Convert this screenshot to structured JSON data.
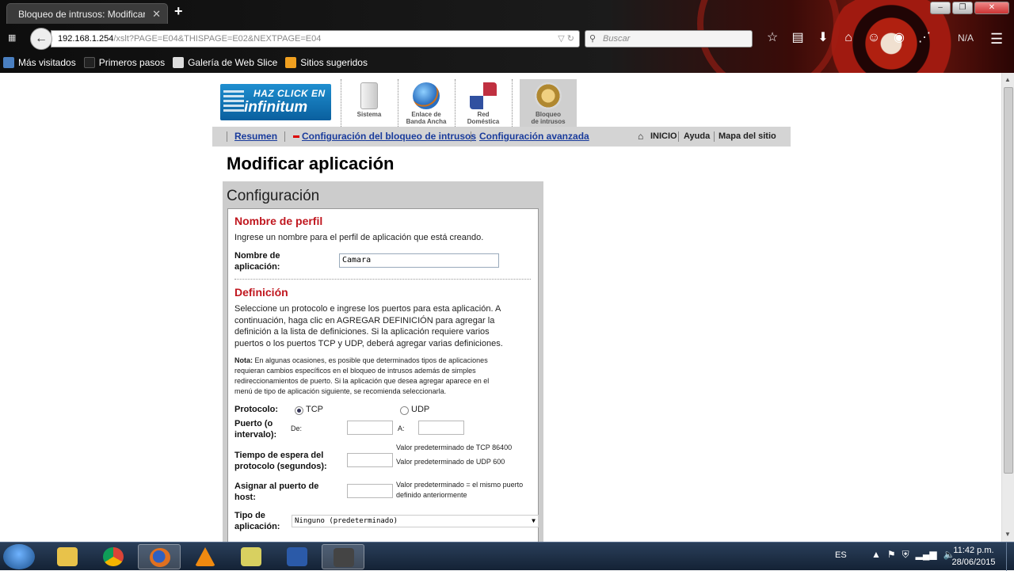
{
  "browser": {
    "tab_title": "Bloqueo de intrusos: Modificar ...",
    "tab_close": "✕",
    "new_tab": "+",
    "url_host": "192.168.1.254",
    "url_path": "/xslt?PAGE=E04&THISPAGE=E02&NEXTPAGE=E04",
    "search_placeholder": "Buscar",
    "na_label": "N/A",
    "window_buttons": [
      "‒",
      "❐",
      "✕"
    ],
    "bookmarks": [
      {
        "label": "Más visitados",
        "color": "#4a7fc0"
      },
      {
        "label": "Primeros pasos",
        "color": "#222222"
      },
      {
        "label": "Galería de Web Slice",
        "color": "#dddddd"
      },
      {
        "label": "Sitios sugeridos",
        "color": "#f0a020"
      }
    ]
  },
  "banner": {
    "logo_line1": "HAZ CLICK EN",
    "logo_line2": "infinitum",
    "tiles": [
      {
        "line1": "Sistema",
        "line2": "",
        "icon": "server-icon",
        "color": "#e6e6e6"
      },
      {
        "line1": "Enlace de",
        "line2": "Banda Ancha",
        "icon": "globe-icon",
        "color": "#3a7fd0"
      },
      {
        "line1": "Red",
        "line2": "Doméstica",
        "icon": "network-icon",
        "color": "#c03040"
      },
      {
        "line1": "Bloqueo",
        "line2": "de intrusos",
        "icon": "lock-icon",
        "color": "#c8a040"
      }
    ]
  },
  "subnav": {
    "resumen": "Resumen",
    "config_bloqueo": "Configuración del bloqueo de intrusos",
    "config_avanzada": "Configuración avanzada",
    "inicio": "INICIO",
    "ayuda": "Ayuda",
    "mapa": "Mapa del sitio"
  },
  "page": {
    "title": "Modificar aplicación",
    "config_heading": "Configuración",
    "perfil": {
      "title": "Nombre de perfil",
      "desc": "Ingrese un nombre para el perfil de aplicación que está creando.",
      "label_line1": "Nombre de",
      "label_line2": "aplicación:",
      "value": "Camara"
    },
    "definicion": {
      "title": "Definición",
      "desc_lines": [
        "Seleccione un protocolo e ingrese los puertos para esta aplicación. A",
        "continuación, haga clic en AGREGAR DEFINICIÓN para agregar la",
        "definición a la lista de definiciones. Si la aplicación requiere varios",
        "puertos o los puertos TCP y UDP, deberá agregar varias definiciones."
      ],
      "note_label": "Nota:",
      "note_lines": [
        " En algunas ocasiones, es posible que determinados tipos de aplicaciones",
        "requieran cambios específicos en el bloqueo de intrusos además de simples",
        "redireccionamientos de puerto. Si la aplicación que desea agregar aparece en el",
        "menú de tipo de aplicación siguiente, se recomienda seleccionarla."
      ],
      "protocolo_label": "Protocolo:",
      "tcp": "TCP",
      "udp": "UDP",
      "protocol_selected": "TCP",
      "puerto_line1": "Puerto (o",
      "puerto_line2": "intervalo):",
      "de": "De:",
      "a": "A:",
      "de_value": "",
      "a_value": "",
      "tiempo_line1": "Tiempo de espera del",
      "tiempo_line2": "protocolo (segundos):",
      "tiempo_value": "",
      "tiempo_hint1": "Valor predeterminado de TCP 86400",
      "tiempo_hint2": "Valor predeterminado de UDP 600",
      "asignar_line1": "Asignar al puerto de",
      "asignar_line2": "host:",
      "asignar_value": "",
      "asignar_hint1": "Valor predeterminado = el mismo puerto",
      "asignar_hint2": "definido anteriormente",
      "tipo_line1": "Tipo de",
      "tipo_line2": "aplicación:",
      "tipo_selected": "Ninguno (predeterminado)"
    }
  },
  "taskbar": {
    "apps": [
      {
        "name": "explorer",
        "color": "#e8c24a",
        "active": false
      },
      {
        "name": "chrome",
        "color": "#4a9a3a",
        "active": false
      },
      {
        "name": "firefox",
        "color": "#e07020",
        "active": true
      },
      {
        "name": "vlc",
        "color": "#f08a10",
        "active": false
      },
      {
        "name": "folder-notes",
        "color": "#d8d060",
        "active": false
      },
      {
        "name": "word",
        "color": "#2b5aa8",
        "active": false
      },
      {
        "name": "media",
        "color": "#444444",
        "active": true
      }
    ],
    "lang": "ES",
    "time": "11:42 p.m.",
    "date": "28/06/2015"
  }
}
